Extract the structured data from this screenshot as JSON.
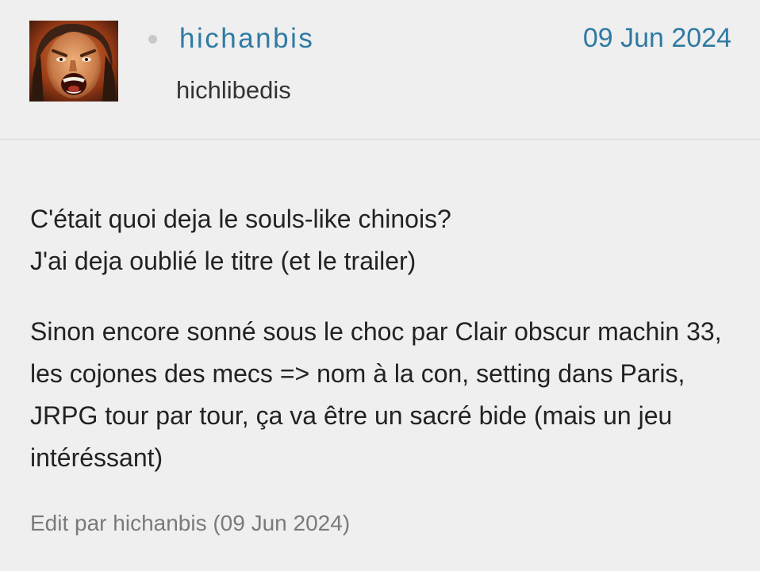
{
  "post": {
    "author": {
      "username": "hichanbis",
      "title": "hichlibedis",
      "avatar_icon": "angry-man-avatar"
    },
    "date": "09 Jun 2024",
    "body": {
      "paragraph1_line1": "C'était quoi deja le souls-like chinois?",
      "paragraph1_line2": "J'ai deja oublié le titre (et le trailer)",
      "paragraph2": "Sinon encore sonné sous le choc par Clair obscur machin 33, les cojones des mecs => nom à la con, setting dans Paris, JRPG tour par tour, ça va être un sacré bide (mais un jeu intéréssant)"
    },
    "edit_note": "Edit par hichanbis (09 Jun 2024)"
  },
  "colors": {
    "background": "#efefef",
    "link": "#2f7aa3",
    "text": "#222222",
    "muted": "#7a7a7a",
    "divider": "#d6d6d6"
  }
}
